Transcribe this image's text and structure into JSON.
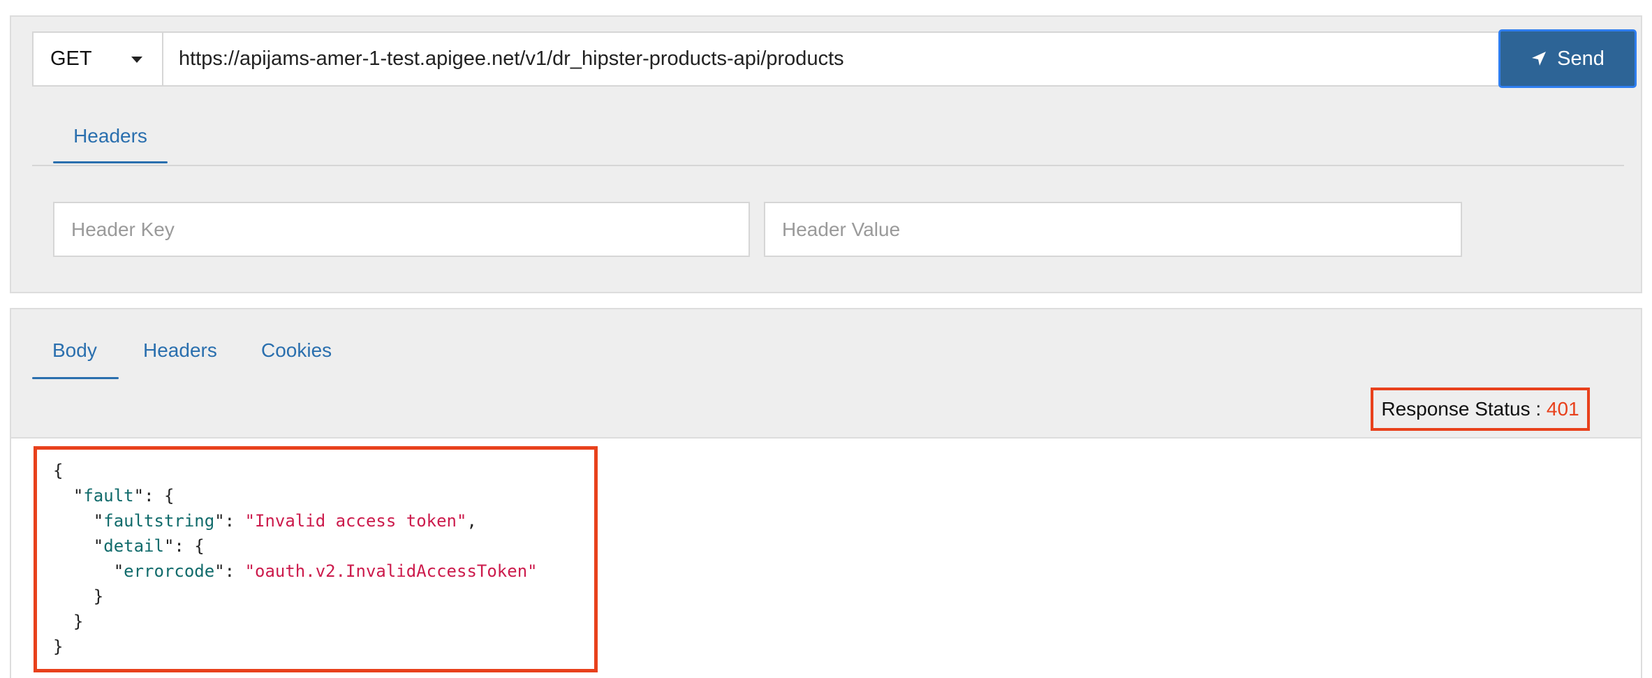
{
  "request": {
    "method": "GET",
    "url": "https://apijams-amer-1-test.apigee.net/v1/dr_hipster-products-api/products",
    "send_label": "Send",
    "tabs": [
      {
        "label": "Headers",
        "active": true
      }
    ],
    "header_key_placeholder": "Header Key",
    "header_value_placeholder": "Header Value"
  },
  "response": {
    "tabs": [
      {
        "label": "Body",
        "active": true
      },
      {
        "label": "Headers",
        "active": false
      },
      {
        "label": "Cookies",
        "active": false
      }
    ],
    "status_label": "Response Status : ",
    "status_code": "401",
    "body": {
      "line1": "{",
      "line2_key": "fault",
      "line2_rest": ": {",
      "line3_key": "faultstring",
      "line3_value": "\"Invalid access token\"",
      "line4_key": "detail",
      "line4_rest": ": {",
      "line5_key": "errorcode",
      "line5_value": "\"oauth.v2.InvalidAccessToken\"",
      "line6": "}",
      "line7": "}",
      "line8": "}"
    }
  },
  "colors": {
    "accent": "#2a6fae",
    "send_button": "#2d6496",
    "highlight": "#e8411c",
    "json_key": "#116b6b",
    "json_string": "#cc1b4c"
  },
  "icons": {
    "send": "paper-plane-icon",
    "method_dropdown": "caret-down-icon"
  }
}
